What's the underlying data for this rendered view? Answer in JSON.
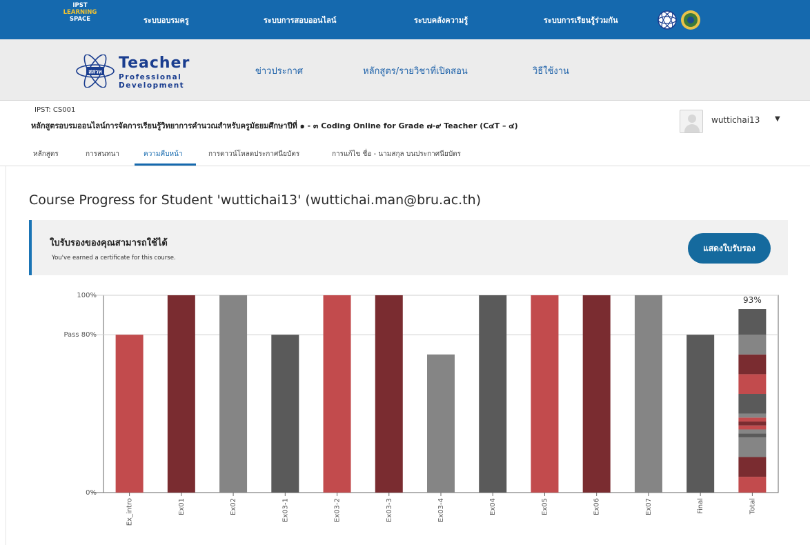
{
  "topbar": {
    "logo": {
      "line1": "IPST",
      "line2": "LEARNING",
      "line3": "SPACE"
    },
    "nav": [
      {
        "label": "ระบบอบรมครู"
      },
      {
        "label": "ระบบการสอบออนไลน์"
      },
      {
        "label": "ระบบคลังความรู้"
      },
      {
        "label": "ระบบการเรียนรู้ร่วมกัน"
      }
    ],
    "emblems": [
      "ipst-emblem-icon",
      "government-seal-icon"
    ]
  },
  "header": {
    "logo": {
      "word1": "Teacher",
      "word2": "Professional",
      "word3": "Development",
      "emblem_text": "สสวท"
    },
    "nav": [
      {
        "label": "ข่าวประกาศ"
      },
      {
        "label": "หลักสูตร/รายวิชาที่เปิดสอน"
      },
      {
        "label": "วิธีใช้งาน"
      }
    ]
  },
  "course": {
    "code": "IPST: CS001",
    "title": "หลักสูตรอบรมออนไลน์การจัดการเรียนรู้วิทยาการคำนวณสำหรับครูมัธยมศึกษาปีที่ ๑ - ๓ Coding Online for Grade ๗-๙ Teacher (C๔T – ๔)",
    "username": "wuttichai13",
    "caret": "▼"
  },
  "tabs": [
    {
      "label": "หลักสูตร",
      "active": false
    },
    {
      "label": "การสนทนา",
      "active": false
    },
    {
      "label": "ความคืบหน้า",
      "active": true
    },
    {
      "label": "การดาวน์โหลดประกาศนียบัตร",
      "active": false
    },
    {
      "label": "การแก้ไข ชื่อ - นามสกุล บนประกาศนียบัตร",
      "active": false
    }
  ],
  "progress": {
    "title": "Course Progress for Student 'wuttichai13' (wuttichai.man@bru.ac.th)",
    "certificate": {
      "title": "ใบรับรองของคุณสามารถใช้ได้",
      "subtitle": "You've earned a certificate for this course.",
      "button": "แสดงใบรับรอง"
    }
  },
  "colors": {
    "red": "#c24b4d",
    "darkred": "#7a2c30",
    "gray": "#858585",
    "darkgray": "#5a5a5a",
    "accent": "#1569ae"
  },
  "chart_data": {
    "type": "bar",
    "categories": [
      "Ex_intro",
      "Ex01",
      "Ex02",
      "Ex03-1",
      "Ex03-2",
      "Ex03-3",
      "Ex03-4",
      "Ex04",
      "Ex05",
      "Ex06",
      "Ex07",
      "Final",
      "Total"
    ],
    "values": [
      80,
      100,
      100,
      80,
      100,
      100,
      70,
      100,
      100,
      100,
      100,
      80,
      93
    ],
    "bar_colors": [
      "red",
      "darkred",
      "gray",
      "darkgray",
      "red",
      "darkred",
      "gray",
      "darkgray",
      "red",
      "darkred",
      "gray",
      "darkgray",
      "stacked"
    ],
    "y_ticks": [
      {
        "value": 0,
        "label": "0%"
      },
      {
        "value": 80,
        "label": "Pass 80%"
      },
      {
        "value": 100,
        "label": "100%"
      }
    ],
    "total_label": "93%",
    "total_segments": [
      {
        "value": 8,
        "color": "red"
      },
      {
        "value": 10,
        "color": "darkred"
      },
      {
        "value": 10,
        "color": "gray"
      },
      {
        "value": 2,
        "color": "darkgray"
      },
      {
        "value": 2,
        "color": "gray"
      },
      {
        "value": 2,
        "color": "red"
      },
      {
        "value": 2,
        "color": "darkred"
      },
      {
        "value": 2,
        "color": "red"
      },
      {
        "value": 2,
        "color": "gray"
      },
      {
        "value": 10,
        "color": "darkgray"
      },
      {
        "value": 10,
        "color": "red"
      },
      {
        "value": 10,
        "color": "darkred"
      },
      {
        "value": 10,
        "color": "gray"
      },
      {
        "value": 13,
        "color": "darkgray"
      }
    ],
    "ylim": [
      0,
      100
    ],
    "grid": true
  }
}
